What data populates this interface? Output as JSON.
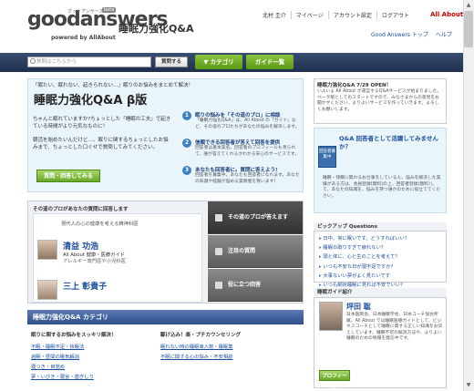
{
  "header": {
    "logo_text": "goodanswers",
    "logo_sub": "グッドアンサーズ",
    "logo_beta": "beta",
    "powered_by": "powered by AllAbout",
    "site_title": "睡眠力強化Q&A",
    "user_name": "北村 圭介",
    "nav": [
      "マイページ",
      "アカウント設定",
      "ログアウト"
    ],
    "allabout_logo": "All About",
    "sub_links": [
      "Good Answers トップ",
      "ヘルプ"
    ]
  },
  "search": {
    "placeholder": "質問はこちらから",
    "button_label": "質問する",
    "category_label": "▼ カテゴリ",
    "guide_label": "ガイド一覧"
  },
  "hero": {
    "tagline": "「眠たい、眠れない、起きられない…」眠りのお悩みをまとめて解決！",
    "title": "睡眠力強化Q&A β版",
    "intro1": "ちゃんと眠れていますか?ちょっとした「睡眠の工夫」で起きている時間がより元気なものに！",
    "intro2": "朝活を始めたいんだけど…、眠りに関するちょっとしたお悩みまで、ちょっとした口ぐせで質問してみてください。",
    "ask_button": "質問・回答してみる",
    "points": [
      {
        "num": "1",
        "title": "眠りの悩みを「その道のプロ」に相談",
        "desc": "「睡眠力強化Q&A」は、All About の「ガイド」など、その道のプロたちがあなたの悩みを解決します。"
      },
      {
        "num": "2",
        "title": "信頼できる回答者が答えて回答を提供",
        "desc": "回答者は基本実名。回答者のプロフィールも見られて、誰が答えてくれるかわかる安心のサービスです。"
      },
      {
        "num": "3",
        "title": "あなたも回答者に。質問に答えよう!",
        "desc": "回答者を募集中。あなたも回答者になれます。あなたの知識や経験が悩める質問者を救います!"
      }
    ]
  },
  "guides": {
    "header": "その道のプロがあなたの質問に回答します",
    "top_line": "現代人の心の健康を考える精神科医",
    "list": [
      {
        "name": "清益 功浩",
        "line1": "All About 健康・医療ガイド",
        "line2": "アレルギー専門医や小児科医"
      },
      {
        "name": "三上 彰貴子",
        "line1": "",
        "line2": ""
      }
    ],
    "tabs": [
      "その道のプロが答えます",
      "注目の質問",
      "役に立つ回答"
    ]
  },
  "categories": {
    "header": "睡眠力強化Q&A カテゴリ",
    "left_head": "眠りに関するお悩みをスッキリ解決！",
    "left_items": [
      "不眠・睡眠不足・快眠法",
      "過眠・昼間の眠気解消",
      "寝つき・目覚め",
      "夢・いびき・寝言・歯ぎしり"
    ],
    "right_head": "駆け込み！楽・プチカウンセリング",
    "right_items": [
      "眠れない時の睡眠導入剤・睡眠薬",
      "不眠に関する心の悩み・不安相談"
    ]
  },
  "open_box": {
    "title": "睡眠力強化Q&A 7/29 OPEN！",
    "body": "いよいよ All About が運営するQ&Aサービスが始まりました。ベータ版としてのスタートですので、みなさまからの意見をお聞かせください。よりよいサービスを作っていきます。よろしくお願いします。"
  },
  "regist": {
    "badge": "回答者募集中",
    "title": "Q&A 回答者として活躍してみませんか？",
    "body": "睡眠・快眠に関わるお仕事をしている人、悩みを解決した実績がある方は、会員登録(無料)の上、回答者登録(無料)して、あなたの知識を、悩みを持つ誰かのために役立ててください。"
  },
  "pickup": {
    "header": "ピックアップ Questions",
    "items": [
      "日中、常に眠いです。どうすればいい？",
      "睡眠の取りすぎて疲れない？",
      "頭と体に、心と生のことを考えて？",
      "いつも不安な日が寝不足ですか？",
      "大事ないい夢がよく見たいです",
      "いつも網状睡眠に見れば不安でいい？"
    ]
  },
  "guide_intro": {
    "header": "睡眠ガイド紹介",
    "name": "坪田 聡",
    "body": "日本医師会、日本睡眠学会、日本コーチ協会所属。All About では睡眠医療ガイドとして、ビジネスコーチとして睡眠に関する正しい知識をお伝えしています。睡眠不足の解消方法や、よりよい睡眠のための情報を発信中です。",
    "profile_button": "プロフィール"
  },
  "colors": {
    "accent_blue": "#1a4fa0",
    "green_button": "#6aa82a",
    "nav_bar": "#2f4f8a"
  }
}
